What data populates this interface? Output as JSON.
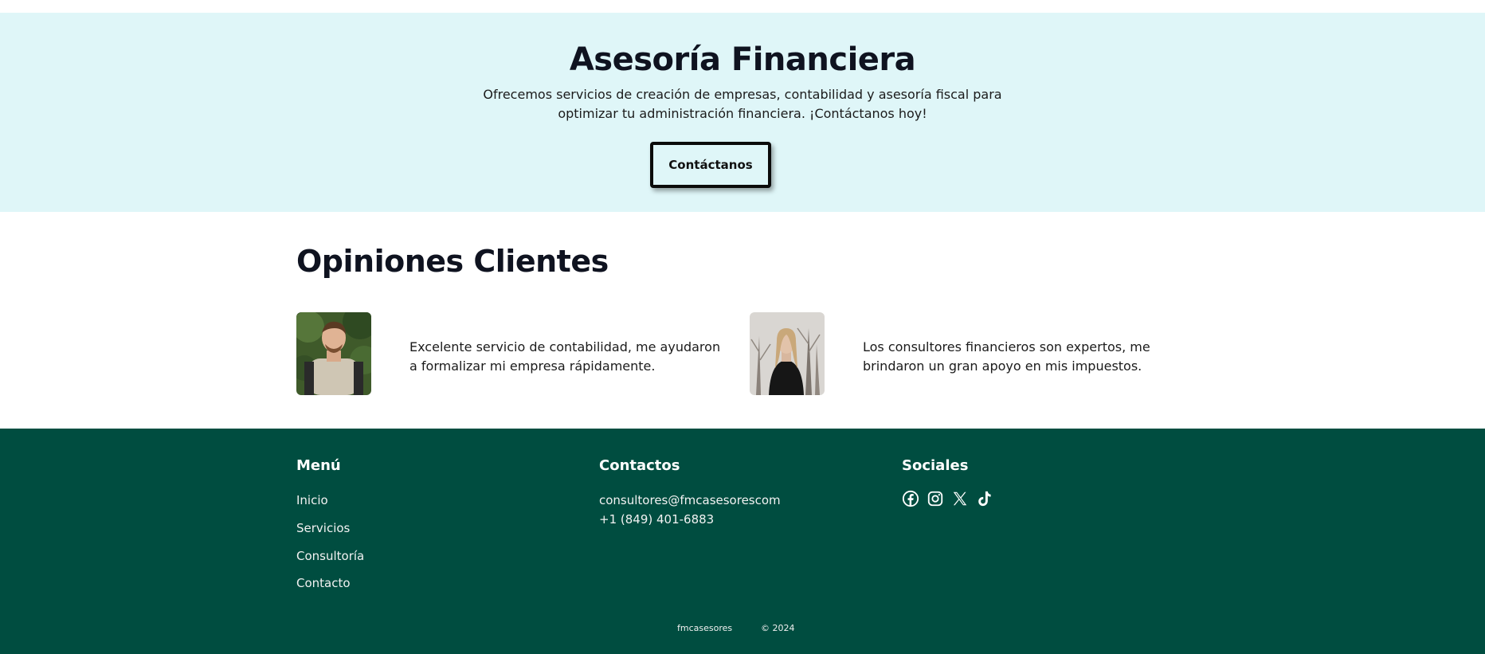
{
  "hero": {
    "title": "Asesoría Financiera",
    "description": "Ofrecemos servicios de creación de empresas, contabilidad y asesoría fiscal para optimizar tu administración financiera. ¡Contáctanos hoy!",
    "cta_label": "Contáctanos",
    "background": "#dff6f8"
  },
  "testimonials": {
    "title": "Opiniones Clientes",
    "items": [
      {
        "text": "Excelente servicio de contabilidad, me ayudaron a formalizar mi empresa rápidamente."
      },
      {
        "text": "Los consultores financieros son expertos, me brindaron un gran apoyo en mis impuestos."
      }
    ]
  },
  "footer": {
    "background": "#004d40",
    "menu": {
      "title": "Menú",
      "items": [
        "Inicio",
        "Servicios",
        "Consultoría",
        "Contacto"
      ]
    },
    "contacts": {
      "title": "Contactos",
      "email": "consultores@fmcasesorescom",
      "phone": "+1 (849) 401-6883"
    },
    "socials": {
      "title": "Sociales",
      "icons": [
        "facebook-icon",
        "instagram-icon",
        "x-icon",
        "tiktok-icon"
      ]
    },
    "brand": "fmcasesores",
    "copyright": "© 2024"
  }
}
